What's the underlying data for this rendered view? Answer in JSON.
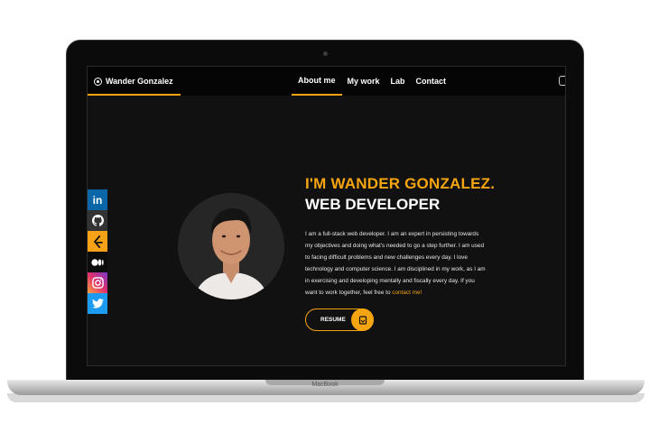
{
  "device": {
    "label": "MacBook"
  },
  "header": {
    "brand": "Wander Gonzalez",
    "nav": [
      "About me",
      "My work",
      "Lab",
      "Contact"
    ]
  },
  "social": [
    "linkedin-icon",
    "github-icon",
    "leetcode-icon",
    "medium-icon",
    "instagram-icon",
    "twitter-icon"
  ],
  "hero": {
    "title_line1": "I'M WANDER GONZALEZ.",
    "title_line2": "WEB DEVELOPER",
    "bio_lines": [
      "I am a full-stack web developer. I am an expert in persisting towards",
      "my objectives and doing what's needed to go a step further. I am used",
      "to facing difficult problems and new challenges every day. I love",
      "technology and computer science. I am disciplined in my work, as I am",
      "in exercising and developing mentally and fiscally every day. If you"
    ],
    "bio_last": "want to work together, feel free to ",
    "bio_link": "contact me!",
    "resume_label": "RESUME"
  },
  "colors": {
    "accent": "#f5a511",
    "background": "#111111"
  }
}
